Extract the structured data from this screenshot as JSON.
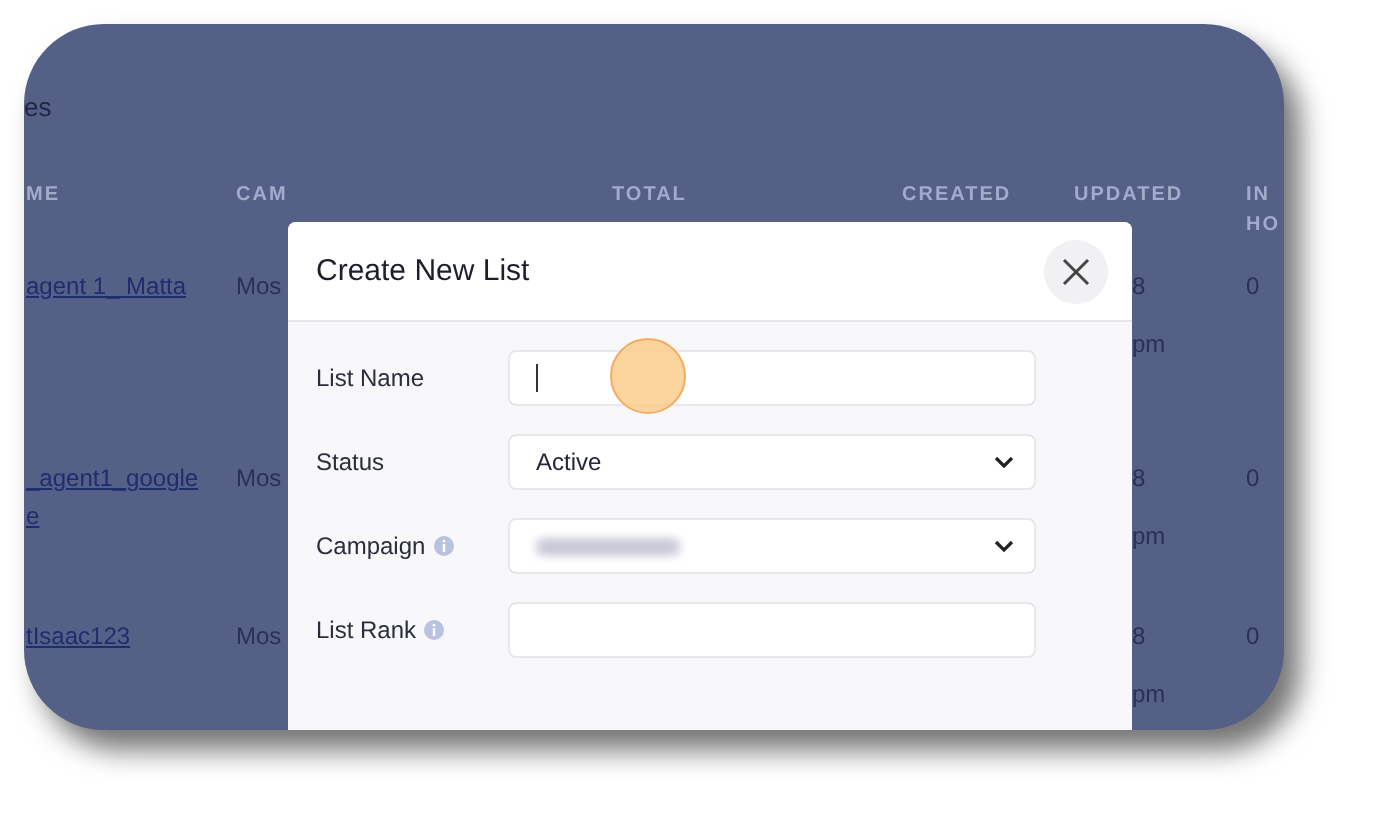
{
  "page_title": "es",
  "table": {
    "columns": [
      {
        "lines": [
          "ME"
        ]
      },
      {
        "lines": [
          "CAM"
        ]
      },
      {
        "lines": [
          "TOTAL"
        ]
      },
      {
        "lines": [
          "CREATED"
        ]
      },
      {
        "lines": [
          "UPDATED"
        ]
      },
      {
        "lines": [
          "IN",
          "HO"
        ]
      }
    ],
    "rows": [
      {
        "name": [
          "agent 1_ Matta"
        ],
        "campaign": "Mos",
        "updated": [
          "8",
          "pm"
        ],
        "in_hold": "0"
      },
      {
        "name": [
          "_agent1_google",
          "e"
        ],
        "campaign": "Mos",
        "updated": [
          "8",
          "pm"
        ],
        "in_hold": "0"
      },
      {
        "name": [
          "tIsaac123"
        ],
        "campaign": "Mos",
        "updated": [
          "8",
          "pm"
        ],
        "in_hold": "0"
      }
    ]
  },
  "dialog": {
    "title": "Create New List",
    "fields": [
      {
        "label": "List Name",
        "kind": "text",
        "focused": true,
        "info": false
      },
      {
        "label": "Status",
        "kind": "select",
        "value": "Active",
        "info": false
      },
      {
        "label": "Campaign",
        "kind": "select",
        "blurred": true,
        "info": true
      },
      {
        "label": "List Rank",
        "kind": "text",
        "focused": false,
        "info": true
      }
    ]
  }
}
